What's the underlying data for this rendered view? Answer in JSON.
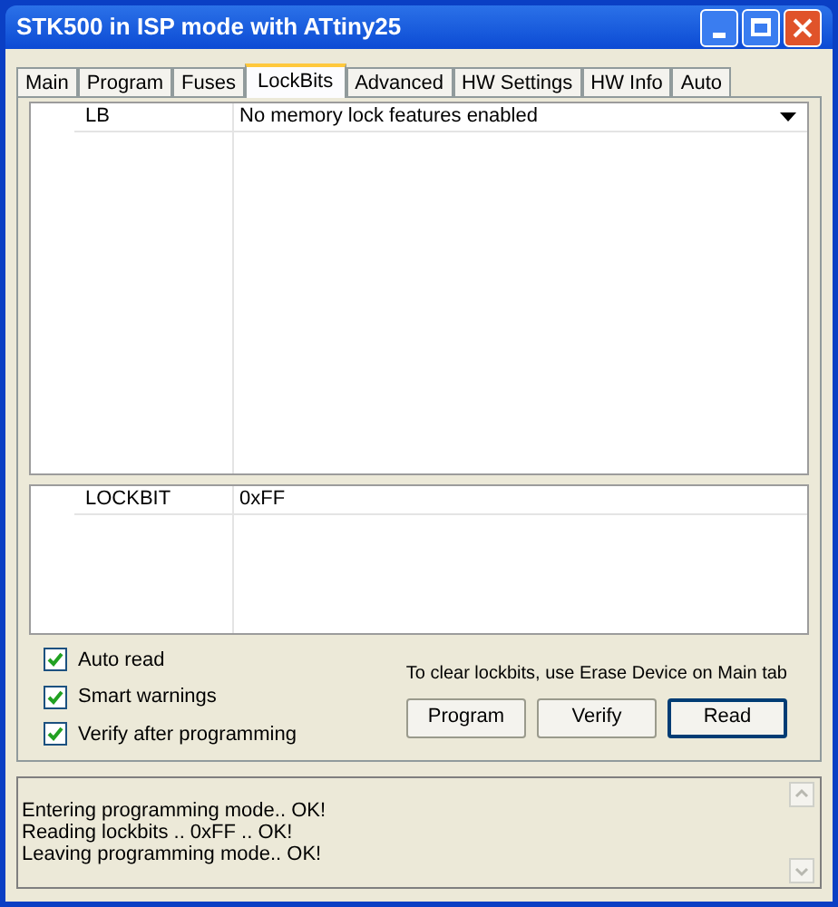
{
  "window": {
    "title": "STK500 in ISP mode with ATtiny25"
  },
  "tabs": [
    {
      "label": "Main",
      "selected": false
    },
    {
      "label": "Program",
      "selected": false
    },
    {
      "label": "Fuses",
      "selected": false
    },
    {
      "label": "LockBits",
      "selected": true
    },
    {
      "label": "Advanced",
      "selected": false
    },
    {
      "label": "HW Settings",
      "selected": false
    },
    {
      "label": "HW Info",
      "selected": false
    },
    {
      "label": "Auto",
      "selected": false
    }
  ],
  "lock_table": {
    "rows": [
      {
        "name": "LB",
        "value": "No memory lock features enabled"
      }
    ]
  },
  "lockbit_table": {
    "rows": [
      {
        "name": "LOCKBIT",
        "value": "0xFF"
      }
    ]
  },
  "options": [
    {
      "label": "Auto read",
      "checked": true
    },
    {
      "label": "Smart warnings",
      "checked": true
    },
    {
      "label": "Verify after programming",
      "checked": true
    }
  ],
  "hint": "To clear lockbits, use Erase Device on Main tab",
  "buttons": [
    {
      "label": "Program",
      "selected": false
    },
    {
      "label": "Verify",
      "selected": false
    },
    {
      "label": "Read",
      "selected": true
    }
  ],
  "log": [
    "Entering programming mode.. OK!",
    "Reading lockbits .. 0xFF .. OK!",
    "Leaving programming mode.. OK!"
  ]
}
